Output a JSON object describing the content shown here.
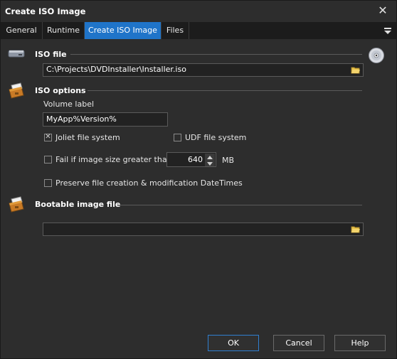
{
  "window": {
    "title": "Create ISO Image",
    "close_symbol": "✕"
  },
  "tabs": [
    {
      "label": "General",
      "active": false
    },
    {
      "label": "Runtime",
      "active": false
    },
    {
      "label": "Create ISO Image",
      "active": true
    },
    {
      "label": "Files",
      "active": false
    }
  ],
  "sections": {
    "iso_file": {
      "title": "ISO file",
      "path_value": "C:\\Projects\\DVDInstaller\\Installer.iso",
      "icon": "drive-icon",
      "side_icon": "cd-disc-icon"
    },
    "iso_options": {
      "title": "ISO options",
      "icon": "filebox-icon",
      "volume_label_caption": "Volume label",
      "volume_label_value": "MyApp%Version%",
      "joliet_label": "Joliet file system",
      "joliet_checked": true,
      "udf_label": "UDF file system",
      "udf_checked": false,
      "fail_size_label": "Fail if image size greater than:",
      "fail_size_checked": false,
      "size_value": "640",
      "size_unit": "MB",
      "preserve_label": "Preserve file creation & modification DateTimes",
      "preserve_checked": false
    },
    "bootable": {
      "title": "Bootable image file",
      "icon": "filebox-icon",
      "path_value": ""
    }
  },
  "buttons": {
    "ok": "OK",
    "cancel": "Cancel",
    "help": "Help"
  },
  "colors": {
    "accent": "#1f74c9",
    "background": "#2d2d2d",
    "field": "#222222"
  }
}
